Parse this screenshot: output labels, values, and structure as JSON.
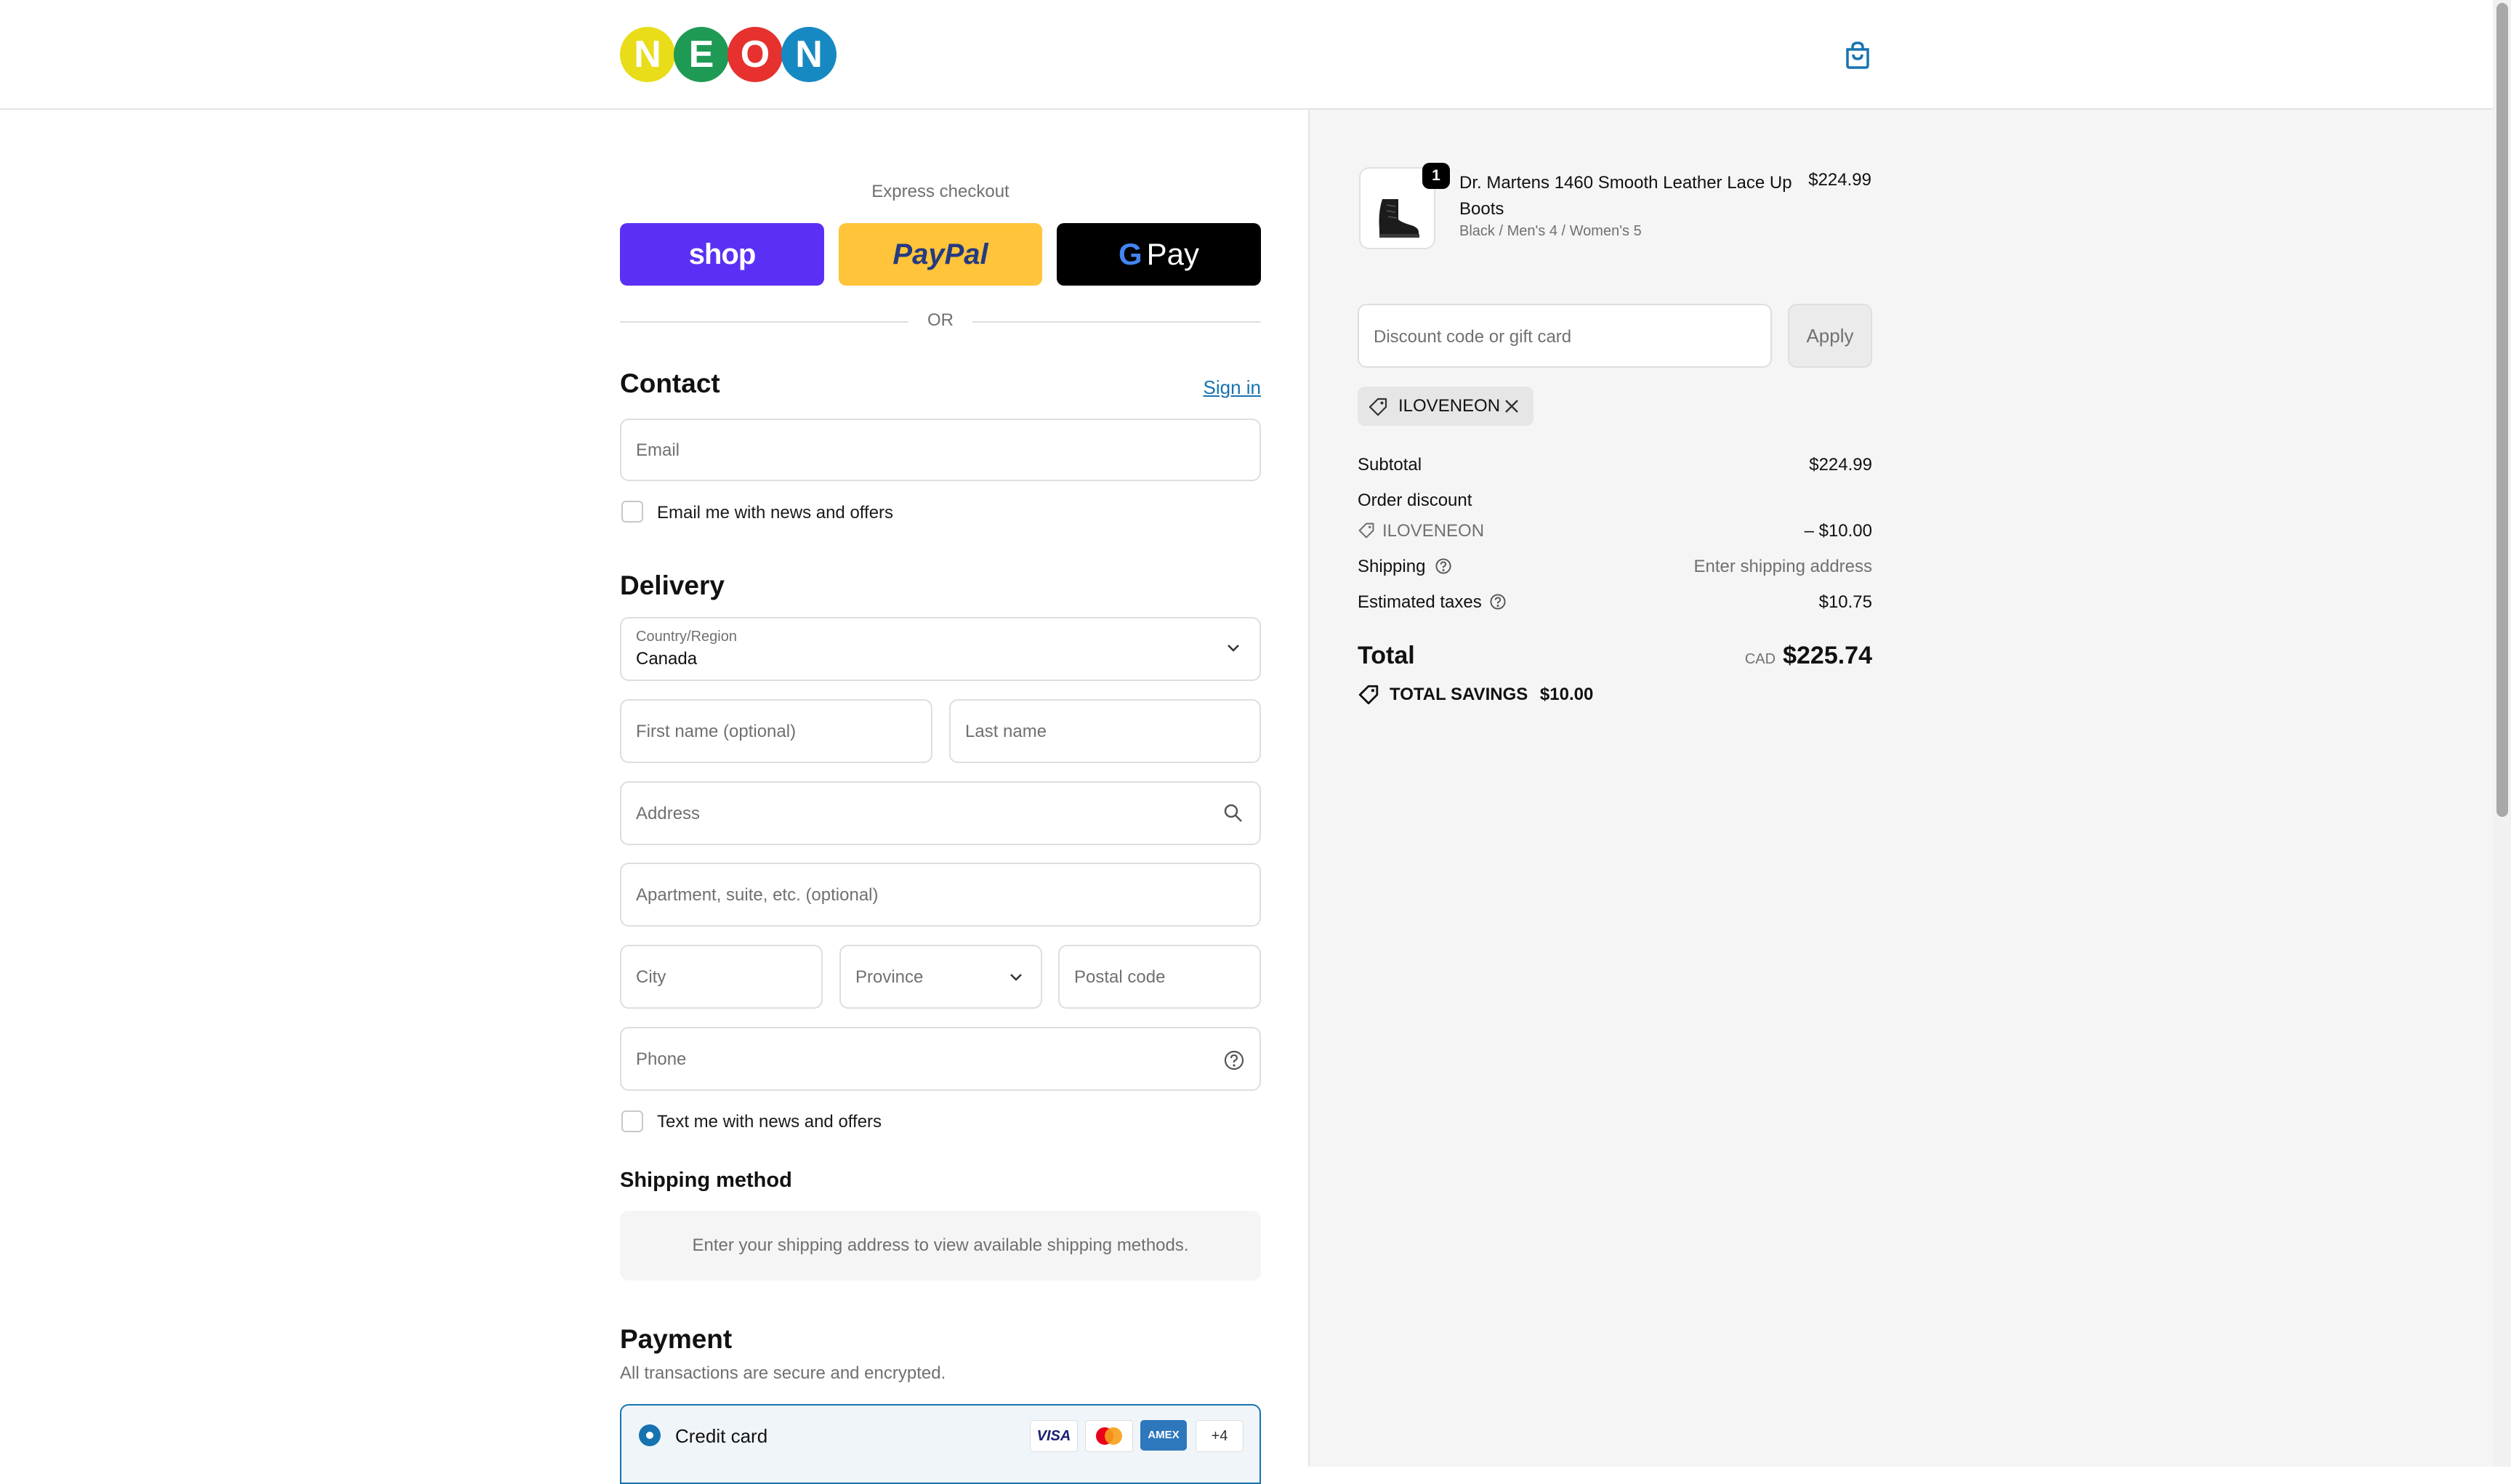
{
  "brand": {
    "letters": [
      {
        "char": "N",
        "color": "#e9dd1a"
      },
      {
        "char": "E",
        "color": "#1f9a55"
      },
      {
        "char": "O",
        "color": "#e6312e"
      },
      {
        "char": "N",
        "color": "#1789c2"
      }
    ]
  },
  "express": {
    "title": "Express checkout",
    "shop_label": "shop",
    "paypal_label": "PayPal",
    "gpay_g": "G",
    "gpay_label": "Pay",
    "or_label": "OR"
  },
  "contact": {
    "title": "Contact",
    "sign_in": "Sign in",
    "email_placeholder": "Email",
    "news_checkbox_label": "Email me with news and offers"
  },
  "delivery": {
    "title": "Delivery",
    "country_label": "Country/Region",
    "country_value": "Canada",
    "first_name_placeholder": "First name (optional)",
    "last_name_placeholder": "Last name",
    "address_placeholder": "Address",
    "apartment_placeholder": "Apartment, suite, etc. (optional)",
    "city_placeholder": "City",
    "province_placeholder": "Province",
    "postal_placeholder": "Postal code",
    "phone_placeholder": "Phone",
    "text_checkbox_label": "Text me with news and offers"
  },
  "shipping_method": {
    "title": "Shipping method",
    "notice": "Enter your shipping address to view available shipping methods."
  },
  "payment": {
    "title": "Payment",
    "subtitle": "All transactions are secure and encrypted.",
    "credit_card_label": "Credit card",
    "card_brands": [
      "VISA",
      "AMEX"
    ],
    "more_cards": "+4"
  },
  "summary": {
    "item": {
      "quantity": "1",
      "name_line1": "Dr. Martens 1460 Smooth Leather Lace Up",
      "name_line2": "Boots",
      "variant": "Black / Men's 4 / Women's 5",
      "price": "$224.99"
    },
    "discount_placeholder": "Discount code or gift card",
    "apply_label": "Apply",
    "applied_code": "ILOVENEON",
    "subtotal_label": "Subtotal",
    "subtotal_value": "$224.99",
    "order_discount_label": "Order discount",
    "discount_code": "ILOVENEON",
    "discount_value": "– $10.00",
    "shipping_label": "Shipping",
    "shipping_value": "Enter shipping address",
    "taxes_label": "Estimated taxes",
    "taxes_value": "$10.75",
    "total_label": "Total",
    "currency": "CAD",
    "total_value": "$225.74",
    "savings_label": "TOTAL SAVINGS",
    "savings_value": "$10.00"
  },
  "colors": {
    "shop": "#5a31f4",
    "paypal": "#ffc439",
    "gpay": "#000000",
    "link": "#1773b0",
    "radio": "#1773b0"
  }
}
